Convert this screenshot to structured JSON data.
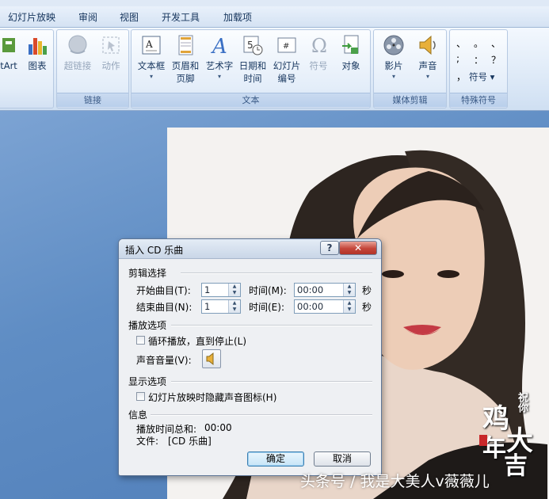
{
  "menubar": {
    "items": [
      "幻灯片放映",
      "审阅",
      "视图",
      "开发工具",
      "加载项"
    ]
  },
  "ribbon": {
    "groups": [
      {
        "name": "插图",
        "label": "",
        "buttons": [
          {
            "label": "tArt"
          },
          {
            "label": "图表"
          }
        ]
      },
      {
        "name": "链接",
        "label": "链接",
        "buttons": [
          {
            "label": "超链接",
            "disabled": true
          },
          {
            "label": "动作",
            "disabled": true
          }
        ]
      },
      {
        "name": "文本",
        "label": "文本",
        "buttons": [
          {
            "line1": "文本框",
            "line2": "▾"
          },
          {
            "line1": "页眉和",
            "line2": "页脚"
          },
          {
            "line1": "艺术字",
            "line2": "▾"
          },
          {
            "line1": "日期和",
            "line2": "时间"
          },
          {
            "line1": "幻灯片",
            "line2": "编号"
          },
          {
            "line1": "符号",
            "line2": "",
            "disabled": true
          },
          {
            "line1": "对象",
            "line2": ""
          }
        ]
      },
      {
        "name": "媒体剪辑",
        "label": "媒体剪辑",
        "buttons": [
          {
            "label": "影片"
          },
          {
            "label": "声音"
          }
        ]
      },
      {
        "name": "特殊符号",
        "label": "特殊符号",
        "symbols": [
          "、",
          "。",
          "、",
          ";",
          "：",
          "？",
          "，"
        ],
        "symbol_button": "符号"
      }
    ]
  },
  "dialog": {
    "title": "插入 CD 乐曲",
    "help_glyph": "?",
    "close_glyph": "✕",
    "clip_section": "剪辑选择",
    "start_track_label": "开始曲目(T):",
    "start_track_value": "1",
    "start_time_label": "时间(M):",
    "start_time_value": "00:00",
    "end_track_label": "结束曲目(N):",
    "end_track_value": "1",
    "end_time_label": "时间(E):",
    "end_time_value": "00:00",
    "seconds_unit": "秒",
    "playback_section": "播放选项",
    "loop_label": "循环播放，直到停止(L)",
    "loop_checked": false,
    "volume_label": "声音音量(V):",
    "display_section": "显示选项",
    "hide_icon_label": "幻灯片放映时隐藏声音图标(H)",
    "hide_icon_checked": false,
    "info_section": "信息",
    "total_time_label": "播放时间总和:",
    "total_time_value": "00:00",
    "file_label": "文件:",
    "file_value": "[CD 乐曲]",
    "ok_label": "确定",
    "cancel_label": "取消"
  },
  "slide": {
    "stamp_small": "祝你",
    "stamp_big_1": "鸡",
    "stamp_big_2": "大",
    "stamp_big_3": "年",
    "stamp_big_4": "吉"
  },
  "watermark": "头条号 / 我是大美人v薇薇儿",
  "colors": {
    "ribbon_text": "#17365e",
    "close_button": "#c5463a",
    "workspace": "#5c87bc",
    "lips": "#c43a44"
  }
}
